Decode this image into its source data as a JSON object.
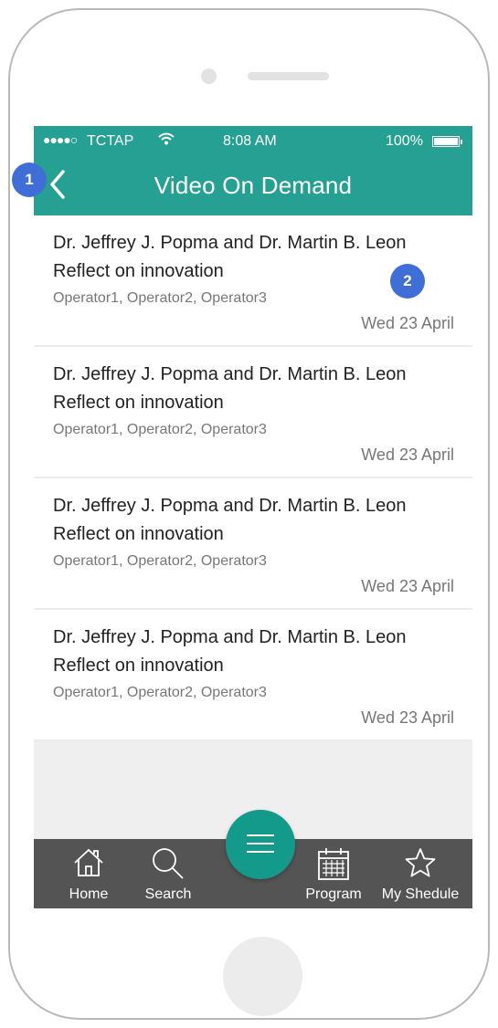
{
  "status_bar": {
    "signal": "●●●●○",
    "carrier": "TCTAP",
    "wifi_icon": "wifi-icon",
    "time": "8:08 AM",
    "battery": "100%"
  },
  "nav": {
    "back_icon": "chevron-left-icon",
    "title": "Video On Demand"
  },
  "videos": [
    {
      "title_line1": "Dr. Jeffrey J. Popma and Dr. Martin B. Leon",
      "title_line2": "Reflect on innovation",
      "operators": "Operator1, Operator2, Operator3",
      "date": "Wed 23 April"
    },
    {
      "title_line1": "Dr. Jeffrey J. Popma and Dr. Martin B. Leon",
      "title_line2": "Reflect on innovation",
      "operators": "Operator1, Operator2, Operator3",
      "date": "Wed 23 April"
    },
    {
      "title_line1": "Dr. Jeffrey J. Popma and Dr. Martin B. Leon",
      "title_line2": "Reflect on innovation",
      "operators": "Operator1, Operator2, Operator3",
      "date": "Wed 23 April"
    },
    {
      "title_line1": "Dr. Jeffrey J. Popma and Dr. Martin B. Leon",
      "title_line2": "Reflect on innovation",
      "operators": "Operator1, Operator2, Operator3",
      "date": "Wed 23 April"
    }
  ],
  "tab_bar": {
    "home": "Home",
    "search": "Search",
    "program": "Program",
    "schedule": "My Shedule",
    "menu_icon": "hamburger-menu-icon"
  },
  "annotations": {
    "badge_1": "1",
    "badge_2": "2"
  },
  "colors": {
    "header": "#26a092",
    "fab": "#139a8b",
    "tab_bar": "#545454",
    "badge": "#3f6fd6"
  }
}
